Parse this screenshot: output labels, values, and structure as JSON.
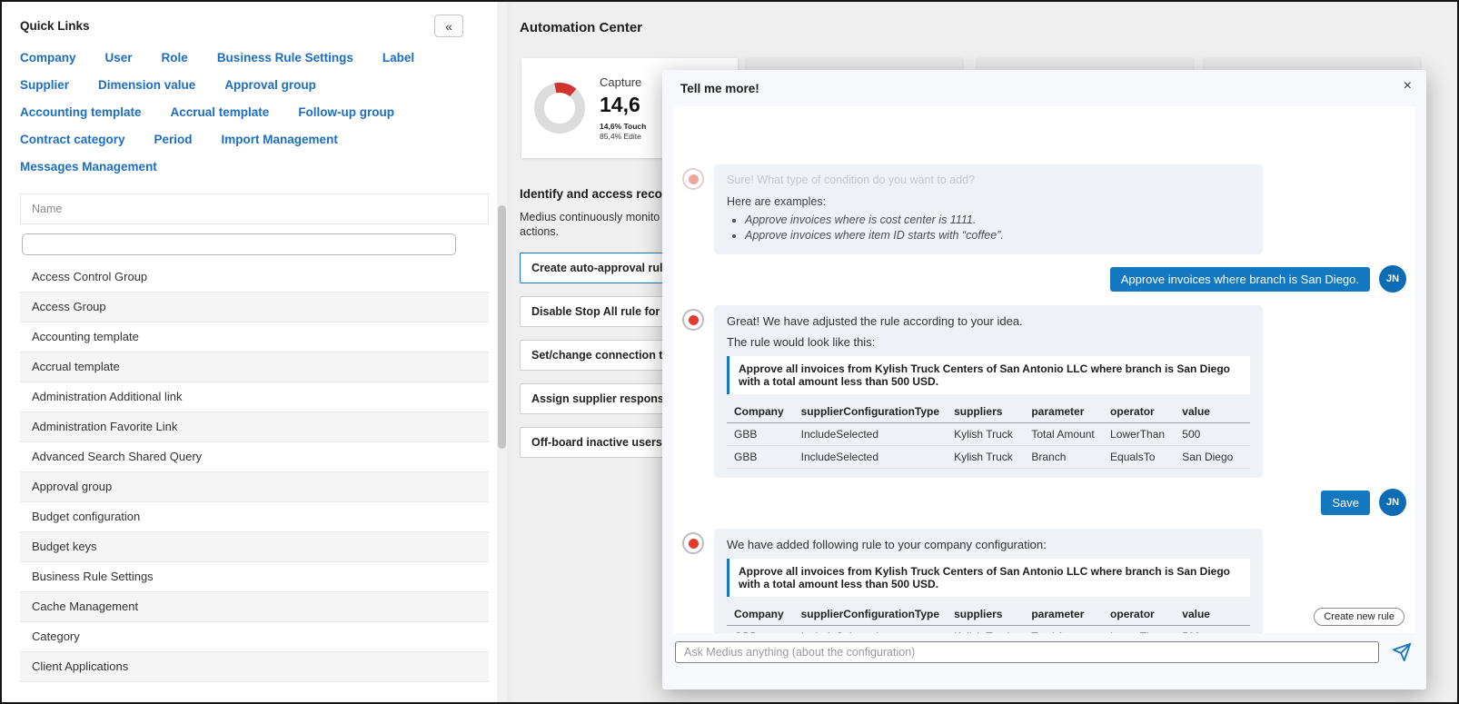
{
  "colors": {
    "accent_blue": "#1b6ec2",
    "user_bubble_blue": "#1478c0",
    "avatar_blue": "#0d6cb3",
    "alert_red": "#e23b2e",
    "donut_red": "#cf352c"
  },
  "quick_links": {
    "title": "Quick Links",
    "collapse_glyph": "«",
    "links": [
      "Company",
      "User",
      "Role",
      "Business Rule Settings",
      "Label",
      "Supplier",
      "Dimension value",
      "Approval group",
      "Accounting template",
      "Accrual template",
      "Follow-up group",
      "Contract category",
      "Period",
      "Import Management",
      "Messages Management"
    ]
  },
  "admin_list": {
    "header": "Name",
    "rows": [
      "Access Control Group",
      "Access Group",
      "Accounting template",
      "Accrual template",
      "Administration Additional link",
      "Administration Favorite Link",
      "Advanced Search Shared Query",
      "Approval group",
      "Budget configuration",
      "Budget keys",
      "Business Rule Settings",
      "Cache Management",
      "Category",
      "Client Applications"
    ]
  },
  "main": {
    "title": "Automation Center",
    "capture_card": {
      "label": "Capture",
      "value": "14,6",
      "stat_line1": "14,6% Touch",
      "stat_line2": "85,4% Edite",
      "donut_percent": 14.6
    },
    "identify": {
      "title": "Identify and access recor",
      "desc_line1": "Medius continuously monito",
      "desc_line2": "actions.",
      "actions": [
        "Create auto-approval rul",
        "Disable Stop All rule for I",
        "Set/change connection t",
        "Assign supplier responsi",
        "Off-board inactive users"
      ]
    }
  },
  "modal": {
    "title": "Tell me more!",
    "close_glyph": "×",
    "bot_intro": {
      "line1": "Sure! What type of condition do you want to add?",
      "examples_label": "Here are examples:",
      "examples": [
        "Approve invoices where is cost center is 1111.",
        "Approve invoices where item ID starts with “coffee”."
      ]
    },
    "user_message1": "Approve invoices where branch is San Diego.",
    "user_initials": "JN",
    "bot_adjusted": {
      "line1": "Great! We have adjusted the rule according to your idea.",
      "line2": "The rule would look like this:"
    },
    "user_message2": "Save",
    "bot_added": {
      "line1": "We have added following rule to your company configuration:"
    },
    "rule_text": "Approve all invoices from  Kylish Truck Centers of San Antonio LLC where branch is San Diego with a total amount less than 500 USD.",
    "rule_table": {
      "headers": [
        "Company",
        "supplierConfigurationType",
        "suppliers",
        "parameter",
        "operator",
        "value"
      ],
      "rows": [
        [
          "GBB",
          "IncludeSelected",
          "Kylish Truck",
          "Total Amount",
          "LowerThan",
          "500"
        ],
        [
          "GBB",
          "IncludeSelected",
          "Kylish Truck",
          "Branch",
          "EqualsTo",
          "San Diego"
        ]
      ]
    },
    "create_new_rule_label": "Create new rule",
    "input_placeholder": "Ask Medius anything (about the configuration)"
  }
}
